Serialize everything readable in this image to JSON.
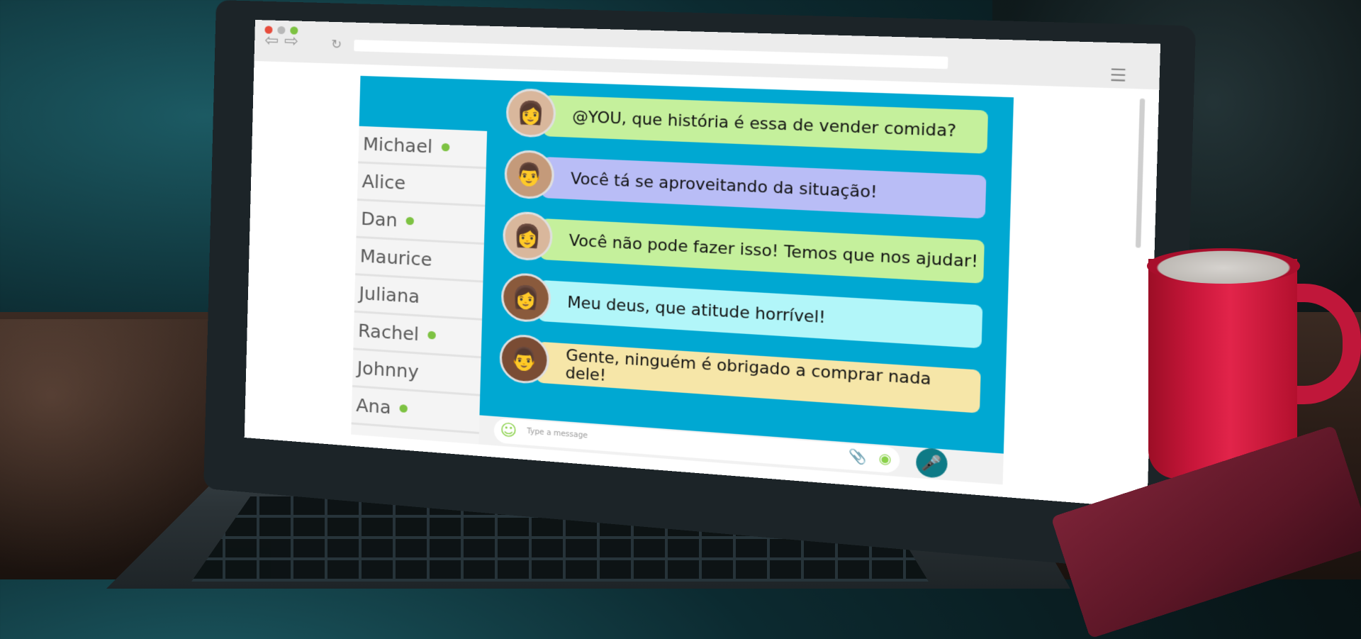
{
  "browser": {
    "url": "",
    "back_icon": "arrow-left-icon",
    "forward_icon": "arrow-right-icon",
    "reload_icon": "reload-icon",
    "menu_icon": "hamburger-menu-icon"
  },
  "contacts": [
    {
      "name": "Michael",
      "online": true
    },
    {
      "name": "Alice",
      "online": false
    },
    {
      "name": "Dan",
      "online": true
    },
    {
      "name": "Maurice",
      "online": false
    },
    {
      "name": "Juliana",
      "online": false
    },
    {
      "name": "Rachel",
      "online": true
    },
    {
      "name": "Johnny",
      "online": false
    },
    {
      "name": "Ana",
      "online": true
    }
  ],
  "messages": [
    {
      "text": "@YOU, que história é essa de vender comida?",
      "color": "#c5f09c"
    },
    {
      "text": "Você tá se aproveitando da situação!",
      "color": "#b9bdf6"
    },
    {
      "text": "Você não pode fazer isso! Temos que nos ajudar!",
      "color": "#c5f09c"
    },
    {
      "text": "Meu deus, que atitude horrível!",
      "color": "#b2f6f9"
    },
    {
      "text": "Gente, ninguém é obrigado a comprar nada dele!",
      "color": "#f6e6a8"
    }
  ],
  "composer": {
    "placeholder": "Type a message",
    "emoji_icon": "smile-icon",
    "attach_icon": "paperclip-icon",
    "camera_icon": "camera-icon",
    "mic_icon": "microphone-icon"
  },
  "colors": {
    "chat_background": "#00a8d2",
    "online_indicator": "#7dc242",
    "mic_button": "#0e7a86"
  }
}
